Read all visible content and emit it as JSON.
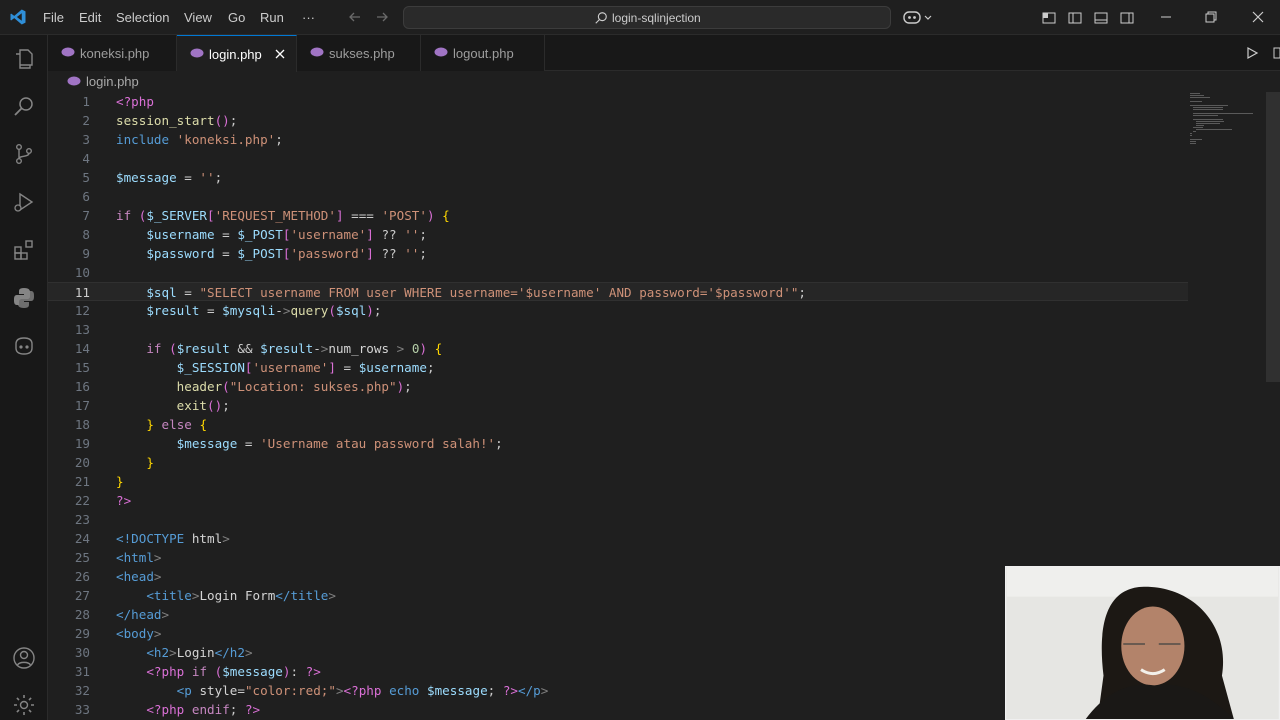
{
  "menu": [
    "File",
    "Edit",
    "Selection",
    "View",
    "Go",
    "Run",
    "···"
  ],
  "command_center": {
    "title": "login-sqlinjection"
  },
  "tabs": [
    {
      "label": "koneksi.php",
      "active": false
    },
    {
      "label": "login.php",
      "active": true
    },
    {
      "label": "sukses.php",
      "active": false
    },
    {
      "label": "logout.php",
      "active": false
    }
  ],
  "breadcrumb": "login.php",
  "current_line": 11,
  "code": [
    {
      "n": "1",
      "t": "<?php"
    },
    {
      "n": "2",
      "t": "session_start();"
    },
    {
      "n": "3",
      "t": "include 'koneksi.php';"
    },
    {
      "n": "4",
      "t": ""
    },
    {
      "n": "5",
      "t": "$message = '';"
    },
    {
      "n": "6",
      "t": ""
    },
    {
      "n": "7",
      "t": "if ($_SERVER['REQUEST_METHOD'] === 'POST') {"
    },
    {
      "n": "8",
      "t": "    $username = $_POST['username'] ?? '';"
    },
    {
      "n": "9",
      "t": "    $password = $_POST['password'] ?? '';"
    },
    {
      "n": "10",
      "t": ""
    },
    {
      "n": "11",
      "t": "    $sql = \"SELECT username FROM user WHERE username='$username' AND password='$password'\";"
    },
    {
      "n": "12",
      "t": "    $result = $mysqli->query($sql);"
    },
    {
      "n": "13",
      "t": ""
    },
    {
      "n": "14",
      "t": "    if ($result && $result->num_rows > 0) {"
    },
    {
      "n": "15",
      "t": "        $_SESSION['username'] = $username;"
    },
    {
      "n": "16",
      "t": "        header(\"Location: sukses.php\");"
    },
    {
      "n": "17",
      "t": "        exit();"
    },
    {
      "n": "18",
      "t": "    } else {"
    },
    {
      "n": "19",
      "t": "        $message = 'Username atau password salah!';"
    },
    {
      "n": "20",
      "t": "    }"
    },
    {
      "n": "21",
      "t": "}"
    },
    {
      "n": "22",
      "t": "?>"
    },
    {
      "n": "23",
      "t": ""
    },
    {
      "n": "24",
      "t": "<!DOCTYPE html>"
    },
    {
      "n": "25",
      "t": "<html>"
    },
    {
      "n": "26",
      "t": "<head>"
    },
    {
      "n": "27",
      "t": "    <title>Login Form</title>"
    },
    {
      "n": "28",
      "t": "</head>"
    },
    {
      "n": "29",
      "t": "<body>"
    },
    {
      "n": "30",
      "t": "    <h2>Login</h2>"
    },
    {
      "n": "31",
      "t": "    <?php if ($message): ?>"
    },
    {
      "n": "32",
      "t": "        <p style=\"color:red;\"><?php echo $message; ?></p>"
    },
    {
      "n": "33",
      "t": "    <?php endif; ?>"
    }
  ],
  "colors": {
    "accent": "#0078d4",
    "editor_bg": "#1f1f1f",
    "php_icon": "#a074c4"
  }
}
